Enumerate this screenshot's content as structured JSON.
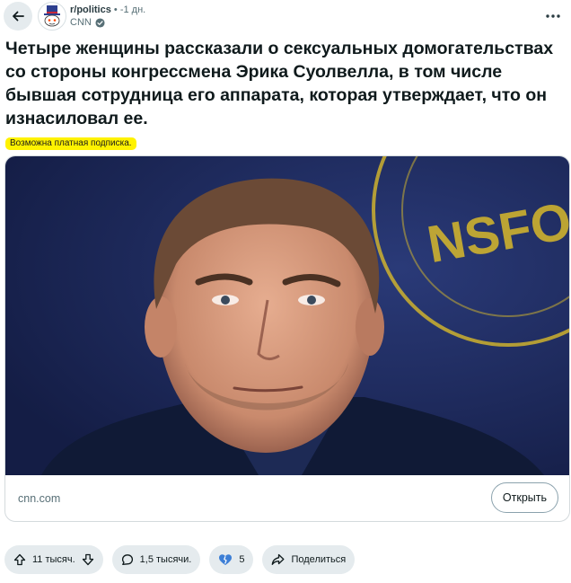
{
  "header": {
    "subreddit": "r/politics",
    "separator": "•",
    "age": "-1 дн.",
    "author": "CNN"
  },
  "post": {
    "title": "Четыре женщины рассказали о сексуальных домогательствах со стороны конгрессмена Эрика Суолвелла, в том числе бывшая сотрудница его аппарата, которая утверждает, что он изнасиловал ее.",
    "paywall_notice": "Возможна платная подписка.",
    "image_text": "NSFO",
    "domain": "cnn.com",
    "open_label": "Открыть"
  },
  "actions": {
    "votes": "11 тысяч.",
    "comments": "1,5 тысячи.",
    "awards": "5",
    "share": "Поделиться"
  },
  "colors": {
    "paywall_highlight": "#fff200",
    "pill_bg": "#e5ebee",
    "photo_bg": "#1f2c5c",
    "emblem_gold": "#d8b92b"
  },
  "icons": [
    "back-arrow-icon",
    "snoo-avatar-icon",
    "verified-icon",
    "more-icon",
    "upvote-icon",
    "downvote-icon",
    "comment-icon",
    "award-icon",
    "share-icon"
  ]
}
